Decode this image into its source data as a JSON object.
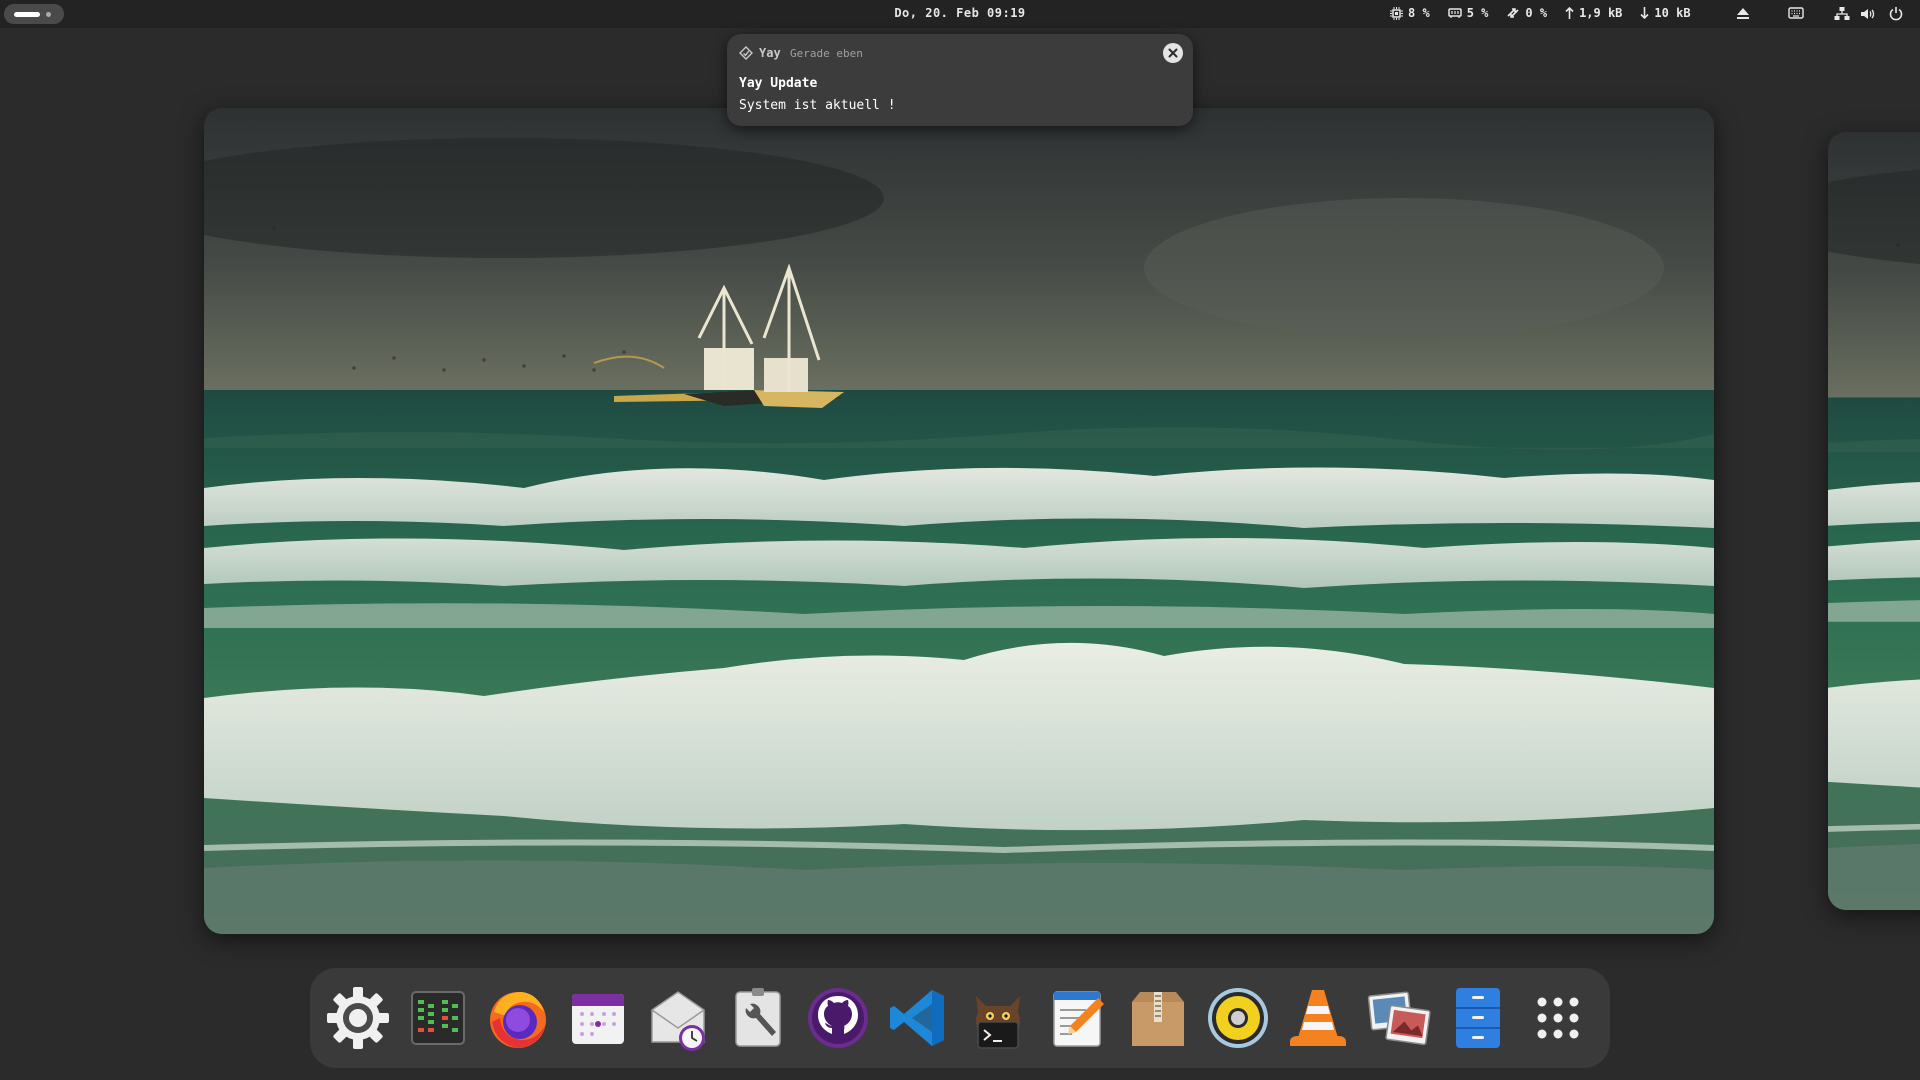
{
  "topbar": {
    "clock": "Do, 20. Feb 09:19",
    "cpu": "8 %",
    "memory": "5 %",
    "swap": "0 %",
    "net_up": "1,9 kB",
    "net_down": "10 kB"
  },
  "notification": {
    "app": "Yay",
    "time": "Gerade eben",
    "title": "Yay Update",
    "body": "System ist aktuell !"
  },
  "dock": {
    "items": [
      "settings",
      "system-monitor",
      "firefox",
      "calendar",
      "mail-scheduler",
      "system-tools",
      "github",
      "vscode",
      "terminal",
      "text-editor",
      "archive-manager",
      "audio-player",
      "vlc",
      "image-viewer",
      "file-manager",
      "app-grid"
    ]
  },
  "colors": {
    "topbar_bg": "#232323",
    "dock_bg": "#3a3a3a",
    "notification_bg": "#3c3c3c",
    "accent_purple": "#7b2fa0",
    "accent_orange": "#f58220"
  }
}
